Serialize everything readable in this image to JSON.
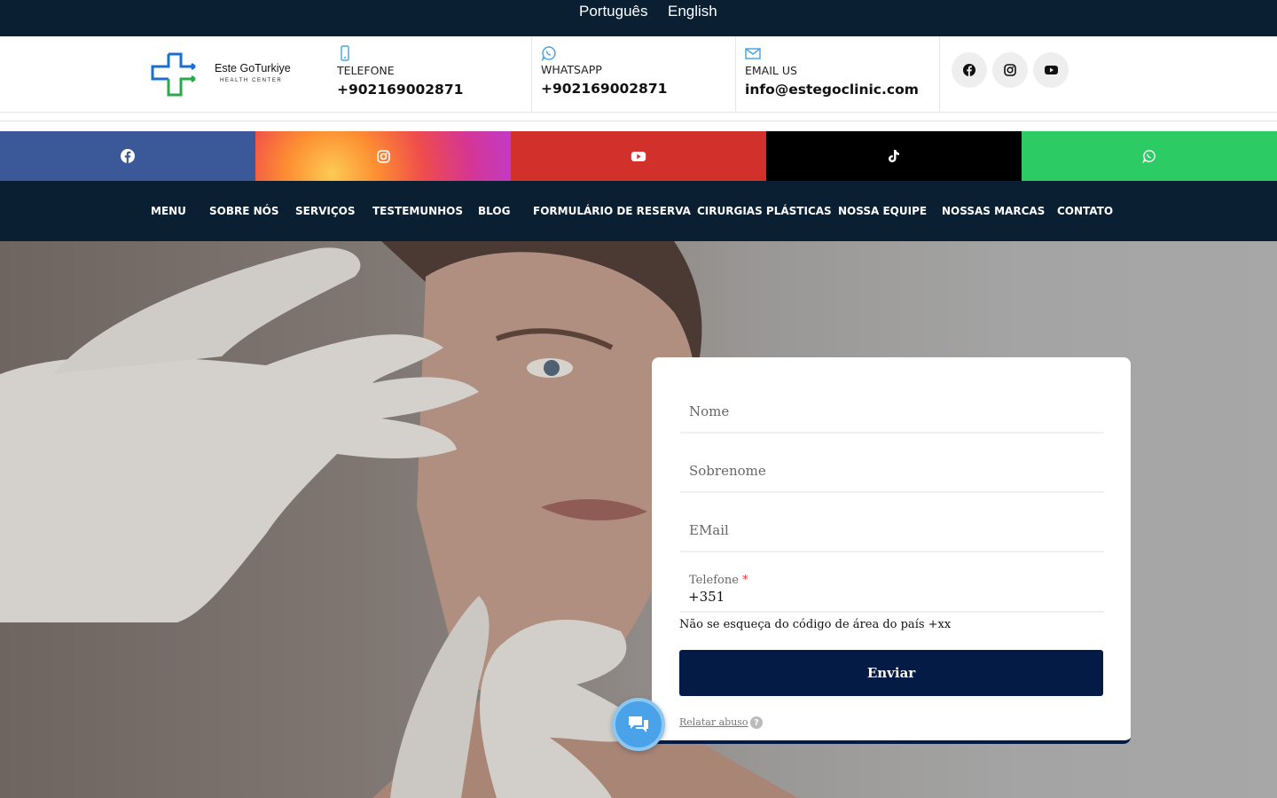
{
  "languages": [
    "Português",
    "English"
  ],
  "logo": {
    "name": "Este GoTurkiye",
    "subtitle": "HEALTH CENTER"
  },
  "contacts": {
    "phone": {
      "label": "TELEFONE",
      "value": "+902169002871",
      "icon": "mobile-phone-icon"
    },
    "whatsapp": {
      "label": "WHATSAPP",
      "value": "+902169002871",
      "icon": "whatsapp-icon"
    },
    "email": {
      "label": "EMAIL US",
      "value": "info@estegoclinic.com",
      "icon": "envelope-icon"
    }
  },
  "header_social": [
    "facebook-icon",
    "instagram-icon",
    "youtube-icon"
  ],
  "social_strip": [
    {
      "icon": "facebook-icon",
      "color": "#3b5998"
    },
    {
      "icon": "instagram-icon",
      "color": "#d53692"
    },
    {
      "icon": "youtube-icon",
      "color": "#d2302a"
    },
    {
      "icon": "tiktok-icon",
      "color": "#000000"
    },
    {
      "icon": "whatsapp-icon",
      "color": "#2ccb63"
    }
  ],
  "nav": [
    "MENU",
    "SOBRE NÓS",
    "SERVIÇOS",
    "TESTEMUNHOS",
    "BLOG",
    "FORMULÁRIO DE RESERVA",
    "CIRURGIAS PLÁSTICAS",
    "NOSSA EQUIPE",
    "NOSSAS MARCAS",
    "CONTATO"
  ],
  "form": {
    "first_name_placeholder": "Nome",
    "last_name_placeholder": "Sobrenome",
    "email_placeholder": "EMail",
    "phone_label": "Telefone",
    "phone_required_mark": "*",
    "phone_value": "+351",
    "hint": "Não se esqueça do código de área do país +xx",
    "submit_label": "Enviar",
    "report_abuse": "Relatar abuso",
    "help_mark": "?"
  },
  "colors": {
    "dark_navy": "#0b1f33",
    "button_navy": "#041c45",
    "chat_blue": "#4aa3e8"
  }
}
